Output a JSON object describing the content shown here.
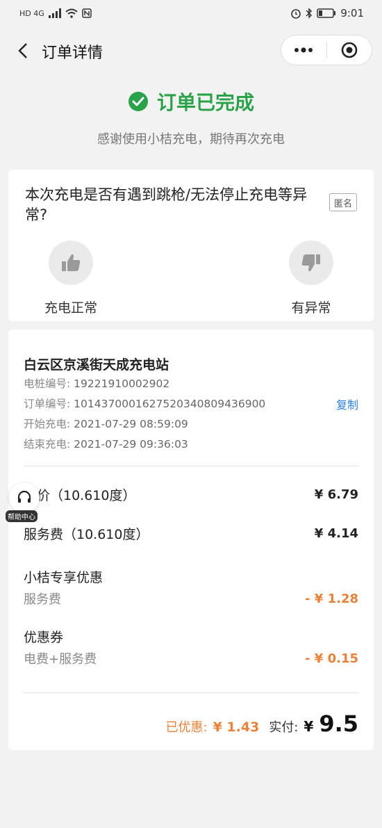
{
  "status_bar": {
    "left_text": "HD 4G",
    "time": "9:01"
  },
  "nav": {
    "title": "订单详情"
  },
  "header": {
    "title": "订单已完成",
    "subtitle": "感谢使用小桔充电，期待再次充电"
  },
  "survey": {
    "question": "本次充电是否有遇到跳枪/无法停止充电等异常?",
    "anon_tag": "匿名",
    "options": [
      {
        "label": "充电正常"
      },
      {
        "label": "有异常"
      }
    ]
  },
  "order": {
    "station": "白云区京溪街天成充电站",
    "pile_label": "电桩编号:",
    "pile_value": "19221910002902",
    "order_label": "订单编号:",
    "order_value": "1014370001627520340809436900",
    "copy_label": "复制",
    "start_label": "开始充电:",
    "start_value": "2021-07-29 08:59:09",
    "end_label": "结束充电:",
    "end_value": "2021-07-29 09:36:03",
    "price_label": "电价（10.610度）",
    "price_amt": "¥ 6.79",
    "service_label": "服务费（10.610度）",
    "service_amt": "¥ 4.14",
    "promo_title": "小桔专享优惠",
    "promo_sub": "服务费",
    "promo_amt": "- ¥ 1.28",
    "coupon_title": "优惠券",
    "coupon_sub": "电费+服务费",
    "coupon_amt": "- ¥ 0.15",
    "discount_label": "已优惠:",
    "discount_amt": "¥ 1.43",
    "paid_label": "实付:",
    "paid_currency": "¥",
    "paid_amt": "9.5"
  },
  "help": {
    "label": "帮助中心"
  },
  "colors": {
    "success": "#2aa24a",
    "discount": "#e8823a",
    "link": "#2f7fd6"
  }
}
